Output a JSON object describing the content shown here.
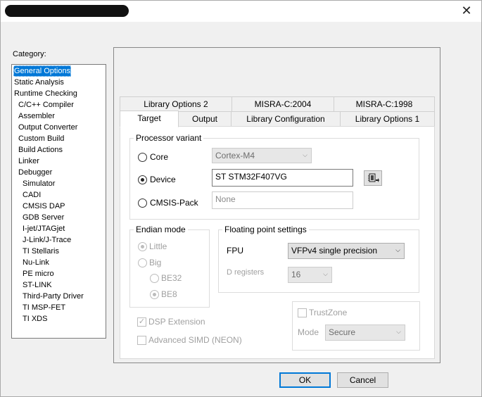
{
  "window": {
    "close_glyph": "✕"
  },
  "category": {
    "label": "Category:",
    "items": [
      {
        "label": "General Options",
        "indent": 0,
        "selected": true
      },
      {
        "label": "Static Analysis",
        "indent": 0
      },
      {
        "label": "Runtime Checking",
        "indent": 0
      },
      {
        "label": "C/C++ Compiler",
        "indent": 1
      },
      {
        "label": "Assembler",
        "indent": 1
      },
      {
        "label": "Output Converter",
        "indent": 1
      },
      {
        "label": "Custom Build",
        "indent": 1
      },
      {
        "label": "Build Actions",
        "indent": 1
      },
      {
        "label": "Linker",
        "indent": 1
      },
      {
        "label": "Debugger",
        "indent": 1
      },
      {
        "label": "Simulator",
        "indent": 2
      },
      {
        "label": "CADI",
        "indent": 2
      },
      {
        "label": "CMSIS DAP",
        "indent": 2
      },
      {
        "label": "GDB Server",
        "indent": 2
      },
      {
        "label": "I-jet/JTAGjet",
        "indent": 2
      },
      {
        "label": "J-Link/J-Trace",
        "indent": 2
      },
      {
        "label": "TI Stellaris",
        "indent": 2
      },
      {
        "label": "Nu-Link",
        "indent": 2
      },
      {
        "label": "PE micro",
        "indent": 2
      },
      {
        "label": "ST-LINK",
        "indent": 2
      },
      {
        "label": "Third-Party Driver",
        "indent": 2
      },
      {
        "label": "TI MSP-FET",
        "indent": 2
      },
      {
        "label": "TI XDS",
        "indent": 2
      }
    ]
  },
  "tabs": {
    "row1": [
      "Library Options 2",
      "MISRA-C:2004",
      "MISRA-C:1998"
    ],
    "row2": [
      "Target",
      "Output",
      "Library Configuration",
      "Library Options 1"
    ],
    "active": "Target"
  },
  "processor": {
    "title": "Processor variant",
    "core_label": "Core",
    "core_value": "Cortex-M4",
    "device_label": "Device",
    "device_value": "ST STM32F407VG",
    "cmsis_label": "CMSIS-Pack",
    "cmsis_value": "None",
    "selected": "Device"
  },
  "endian": {
    "title": "Endian mode",
    "little": "Little",
    "big": "Big",
    "be32": "BE32",
    "be8": "BE8"
  },
  "fpu": {
    "title": "Floating point settings",
    "fpu_label": "FPU",
    "fpu_value": "VFPv4 single precision",
    "dreg_label": "D registers",
    "dreg_value": "16"
  },
  "dsp": {
    "label": "DSP Extension",
    "checked": true
  },
  "simd": {
    "label": "Advanced SIMD (NEON)",
    "checked": false
  },
  "trustzone": {
    "label": "TrustZone",
    "mode_label": "Mode",
    "mode_value": "Secure"
  },
  "buttons": {
    "ok": "OK",
    "cancel": "Cancel"
  }
}
